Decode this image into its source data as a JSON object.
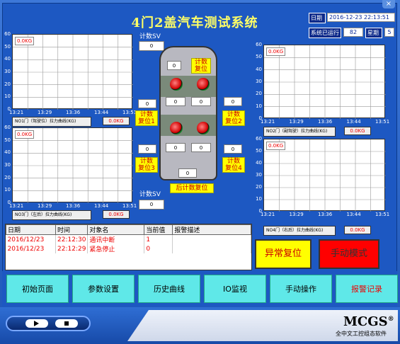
{
  "window": {
    "title": "4门2盖汽车测试系统",
    "close_glyph": "×"
  },
  "header": {
    "date_label": "日期",
    "datetime": "2016-12-23 22:13:51",
    "run_label": "系统已运行",
    "run_value": "82",
    "week_label": "星期",
    "week_value": "5"
  },
  "center": {
    "count_sv_label": "计数SV",
    "count_sv_value": "0",
    "count_sv2_label": "计数SV",
    "count_sv2_value": "0",
    "top_value": "0",
    "top_reset": "计数\n复位",
    "reset1": "计数\n复位1",
    "reset2": "计数\n复位2",
    "reset3": "计数\n复位3",
    "reset4": "计数\n复位4",
    "back_reset": "后计数复位",
    "box_values": [
      "0",
      "0",
      "0",
      "0",
      "0",
      "0",
      "0",
      "0",
      "0",
      "0",
      "0"
    ]
  },
  "charts": [
    {
      "id": "no1",
      "caption": "NO1门（驾驶位）拉力曲线(KG)",
      "badge": "0.0KG",
      "value": "0.0KG",
      "yticks": [
        "60",
        "50",
        "40",
        "30",
        "20",
        "10",
        "0"
      ],
      "xticks": [
        "13:21",
        "13:29",
        "13:36",
        "13:44",
        "13:51"
      ]
    },
    {
      "id": "no2",
      "caption": "NO2门（副驾驶）拉力曲线(KG)",
      "badge": "0.0KG",
      "value": "0.0KG",
      "yticks": [
        "60",
        "50",
        "40",
        "30",
        "20",
        "10",
        "0"
      ],
      "xticks": [
        "13:21",
        "13:29",
        "13:36",
        "13:44",
        "13:51"
      ]
    },
    {
      "id": "no3",
      "caption": "NO3门（左后）拉力曲线(KG)",
      "badge": "0.0KG",
      "value": "0.0KG",
      "yticks": [
        "60",
        "50",
        "40",
        "30",
        "20",
        "10",
        "0"
      ],
      "xticks": [
        "13:21",
        "13:29",
        "13:36",
        "13:44",
        "13:51"
      ]
    },
    {
      "id": "no4",
      "caption": "NO4门（右后）拉力曲线(KG)",
      "badge": "0.0KG",
      "value": "0.0KG",
      "yticks": [
        "60",
        "50",
        "40",
        "30",
        "20",
        "10",
        "0"
      ],
      "xticks": [
        "13:21",
        "13:29",
        "13:36",
        "13:44",
        "13:51"
      ]
    }
  ],
  "alarm": {
    "headers": [
      "日期",
      "时间",
      "对象名",
      "当前值",
      "报警描述"
    ],
    "rows": [
      [
        "2016/12/23",
        "22:12:30",
        "通讯中断",
        "1",
        ""
      ],
      [
        "2016/12/23",
        "22:12:29",
        "紧急停止",
        "0",
        ""
      ]
    ]
  },
  "buttons": {
    "abnormal_reset": "异常复位",
    "manual_mode": "手动模式"
  },
  "nav": [
    "初始页面",
    "参数设置",
    "历史曲线",
    "IO监视",
    "手动操作",
    "报警记录"
  ],
  "brand": {
    "name": "MCGS",
    "reg": "®",
    "subtitle": "全中文工控组态软件"
  },
  "colors": {
    "frame": "#1d58c2",
    "title": "#ffff66",
    "alarm_text": "#ee0000",
    "nav": "#5fe8e8",
    "manual_mode": "#ff0000"
  }
}
